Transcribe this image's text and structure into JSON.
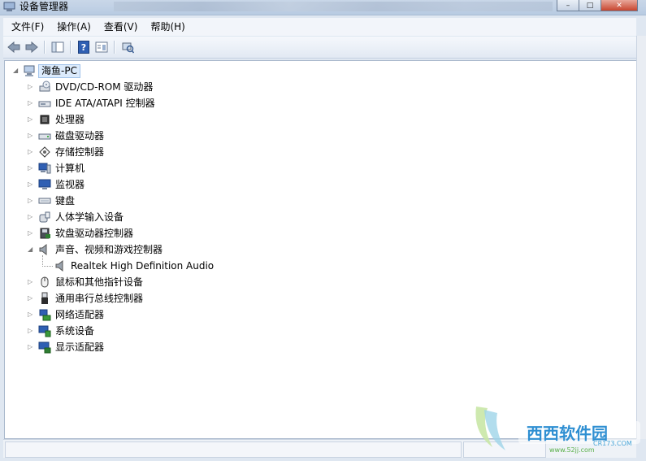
{
  "window": {
    "title": "设备管理器",
    "controls": [
      "–",
      "□",
      "✕"
    ]
  },
  "menu": [
    {
      "label": "文件(F)"
    },
    {
      "label": "操作(A)"
    },
    {
      "label": "查看(V)"
    },
    {
      "label": "帮助(H)"
    }
  ],
  "toolbar": {
    "buttons": [
      "back-icon",
      "forward-icon",
      "show-hide-console-tree-icon",
      "help-icon",
      "properties-icon",
      "scan-hardware-icon"
    ]
  },
  "tree": {
    "root": "海鱼-PC",
    "categories": [
      {
        "label": "DVD/CD-ROM 驱动器",
        "icon": "dvd-drive-icon"
      },
      {
        "label": "IDE ATA/ATAPI 控制器",
        "icon": "ide-controller-icon"
      },
      {
        "label": "处理器",
        "icon": "processor-icon"
      },
      {
        "label": "磁盘驱动器",
        "icon": "disk-drive-icon"
      },
      {
        "label": "存储控制器",
        "icon": "storage-controller-icon"
      },
      {
        "label": "计算机",
        "icon": "computer-icon"
      },
      {
        "label": "监视器",
        "icon": "monitor-icon"
      },
      {
        "label": "键盘",
        "icon": "keyboard-icon"
      },
      {
        "label": "人体学输入设备",
        "icon": "hid-icon"
      },
      {
        "label": "软盘驱动器控制器",
        "icon": "floppy-controller-icon"
      },
      {
        "label": "声音、视频和游戏控制器",
        "icon": "speaker-icon",
        "expanded": true,
        "children": [
          {
            "label": "Realtek High Definition Audio",
            "icon": "speaker-icon"
          }
        ]
      },
      {
        "label": "鼠标和其他指针设备",
        "icon": "mouse-icon"
      },
      {
        "label": "通用串行总线控制器",
        "icon": "usb-icon"
      },
      {
        "label": "网络适配器",
        "icon": "network-adapter-icon"
      },
      {
        "label": "系统设备",
        "icon": "system-device-icon"
      },
      {
        "label": "显示适配器",
        "icon": "display-adapter-icon"
      }
    ]
  },
  "watermark": {
    "brand": "西西软件园",
    "site": "www.52jj.com",
    "sub": "CR173.COM"
  }
}
